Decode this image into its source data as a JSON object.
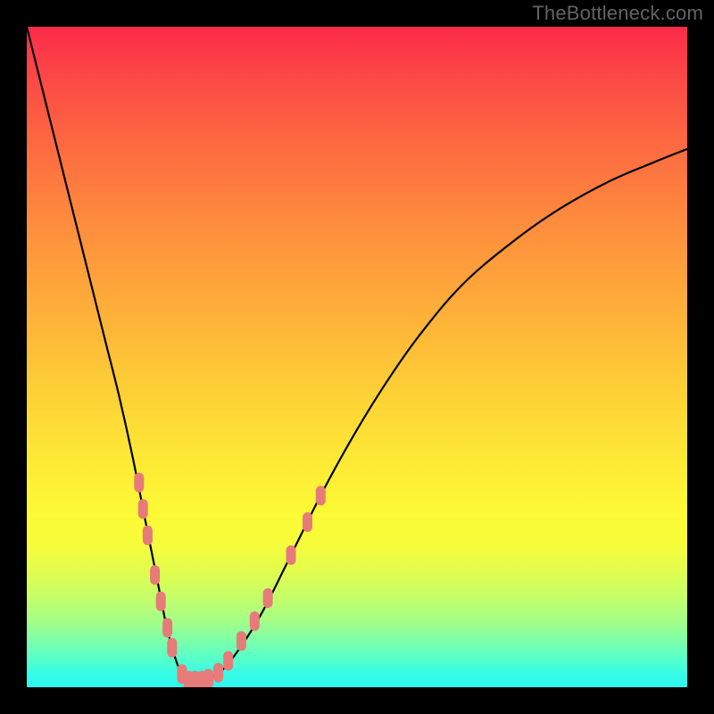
{
  "watermark": "TheBottleneck.com",
  "chart_data": {
    "type": "line",
    "title": "",
    "xlabel": "",
    "ylabel": "",
    "xlim": [
      0,
      100
    ],
    "ylim": [
      0,
      100
    ],
    "curve": {
      "name": "bottleneck-curve",
      "x": [
        0,
        2,
        4,
        6,
        8,
        10,
        12,
        14,
        16,
        18,
        19,
        20,
        21,
        22,
        23,
        24,
        25,
        26,
        28,
        30,
        33,
        36,
        40,
        45,
        50,
        55,
        60,
        66,
        73,
        80,
        88,
        95,
        100
      ],
      "y": [
        100,
        92,
        84,
        76,
        68,
        60,
        52,
        44,
        35,
        25,
        20,
        15,
        10,
        6,
        3,
        1.5,
        1,
        1,
        1.5,
        3,
        7,
        12,
        20,
        30,
        39,
        47,
        54,
        61,
        67,
        72,
        76.5,
        79.5,
        81.5
      ]
    },
    "pink_markers": [
      {
        "x": 17.0,
        "y": 31.0
      },
      {
        "x": 17.6,
        "y": 27.0
      },
      {
        "x": 18.3,
        "y": 23.0
      },
      {
        "x": 19.4,
        "y": 17.0
      },
      {
        "x": 20.3,
        "y": 13.0
      },
      {
        "x": 21.3,
        "y": 9.0
      },
      {
        "x": 22.0,
        "y": 6.0
      },
      {
        "x": 23.5,
        "y": 2.0
      },
      {
        "x": 24.5,
        "y": 1.0
      },
      {
        "x": 25.5,
        "y": 1.0
      },
      {
        "x": 26.5,
        "y": 1.0
      },
      {
        "x": 27.5,
        "y": 1.3
      },
      {
        "x": 29.0,
        "y": 2.2
      },
      {
        "x": 30.5,
        "y": 4.0
      },
      {
        "x": 32.5,
        "y": 7.0
      },
      {
        "x": 34.5,
        "y": 10.0
      },
      {
        "x": 36.5,
        "y": 13.5
      },
      {
        "x": 40.0,
        "y": 20.0
      },
      {
        "x": 42.5,
        "y": 25.0
      },
      {
        "x": 44.5,
        "y": 29.0
      }
    ],
    "gradient_stops": [
      {
        "pos": 0,
        "color": "#fb2b4a"
      },
      {
        "pos": 50,
        "color": "#fde035"
      },
      {
        "pos": 100,
        "color": "#2df7f0"
      }
    ]
  }
}
